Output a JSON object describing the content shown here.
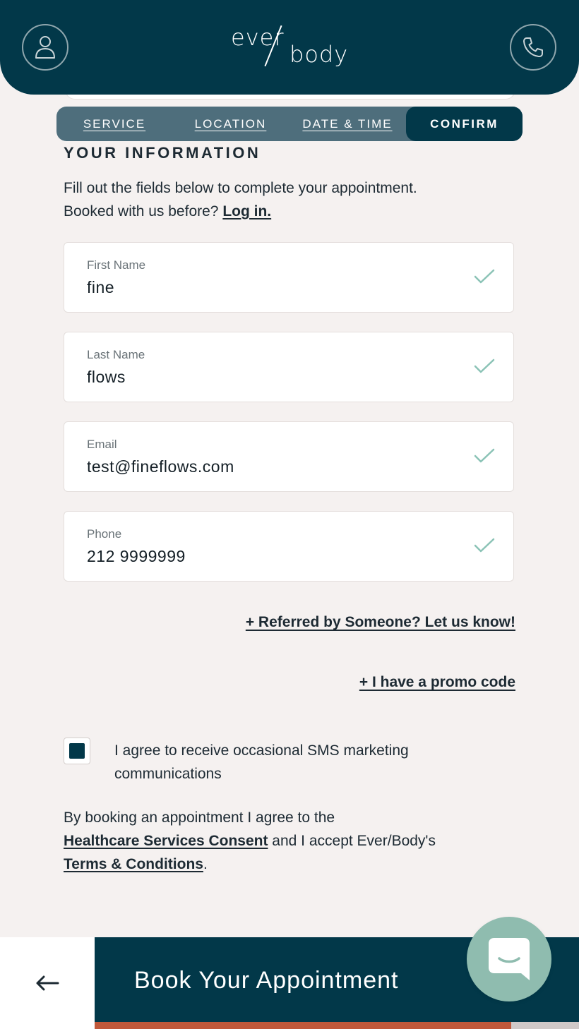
{
  "brand": {
    "logo_part1": "ever",
    "logo_part2": "body"
  },
  "header": {
    "account_icon": "user-icon",
    "call_icon": "phone-icon"
  },
  "steps": [
    {
      "label": "SERVICE",
      "active": false
    },
    {
      "label": "LOCATION",
      "active": false
    },
    {
      "label": "DATE & TIME",
      "active": false
    },
    {
      "label": "CONFIRM",
      "active": true
    }
  ],
  "section": {
    "title": "YOUR INFORMATION",
    "intro_line1": "Fill out the fields below to complete your appointment.",
    "intro_line2": "Booked with us before?",
    "login_link": "Log in."
  },
  "fields": [
    {
      "label": "First Name",
      "value": "fine",
      "valid": true
    },
    {
      "label": "Last Name",
      "value": "flows",
      "valid": true
    },
    {
      "label": "Email",
      "value": "test@fineflows.com",
      "valid": true
    },
    {
      "label": "Phone",
      "value": "212 9999999",
      "valid": true
    }
  ],
  "links": {
    "referred": "+ Referred by Someone? Let us know!",
    "promo": "+ I have a promo code"
  },
  "sms_consent": {
    "checked": true,
    "label": "I agree to receive occasional SMS marketing communications"
  },
  "legal": {
    "prefix": "By booking an appointment I agree to the",
    "consent_link": "Healthcare Services Consent",
    "middle": " and I accept Ever/Body's ",
    "terms_link": "Terms & Conditions",
    "suffix": "."
  },
  "footer": {
    "back_icon": "arrow-left-icon",
    "book_label": "Book Your Appointment",
    "progress": 0.86,
    "chat_icon": "chat-icon"
  },
  "colors": {
    "primary": "#023849",
    "tab_bar": "#4e6e7c",
    "check": "#8bc3b6",
    "chat": "#8fbcaf",
    "progress": "#c0583a"
  }
}
